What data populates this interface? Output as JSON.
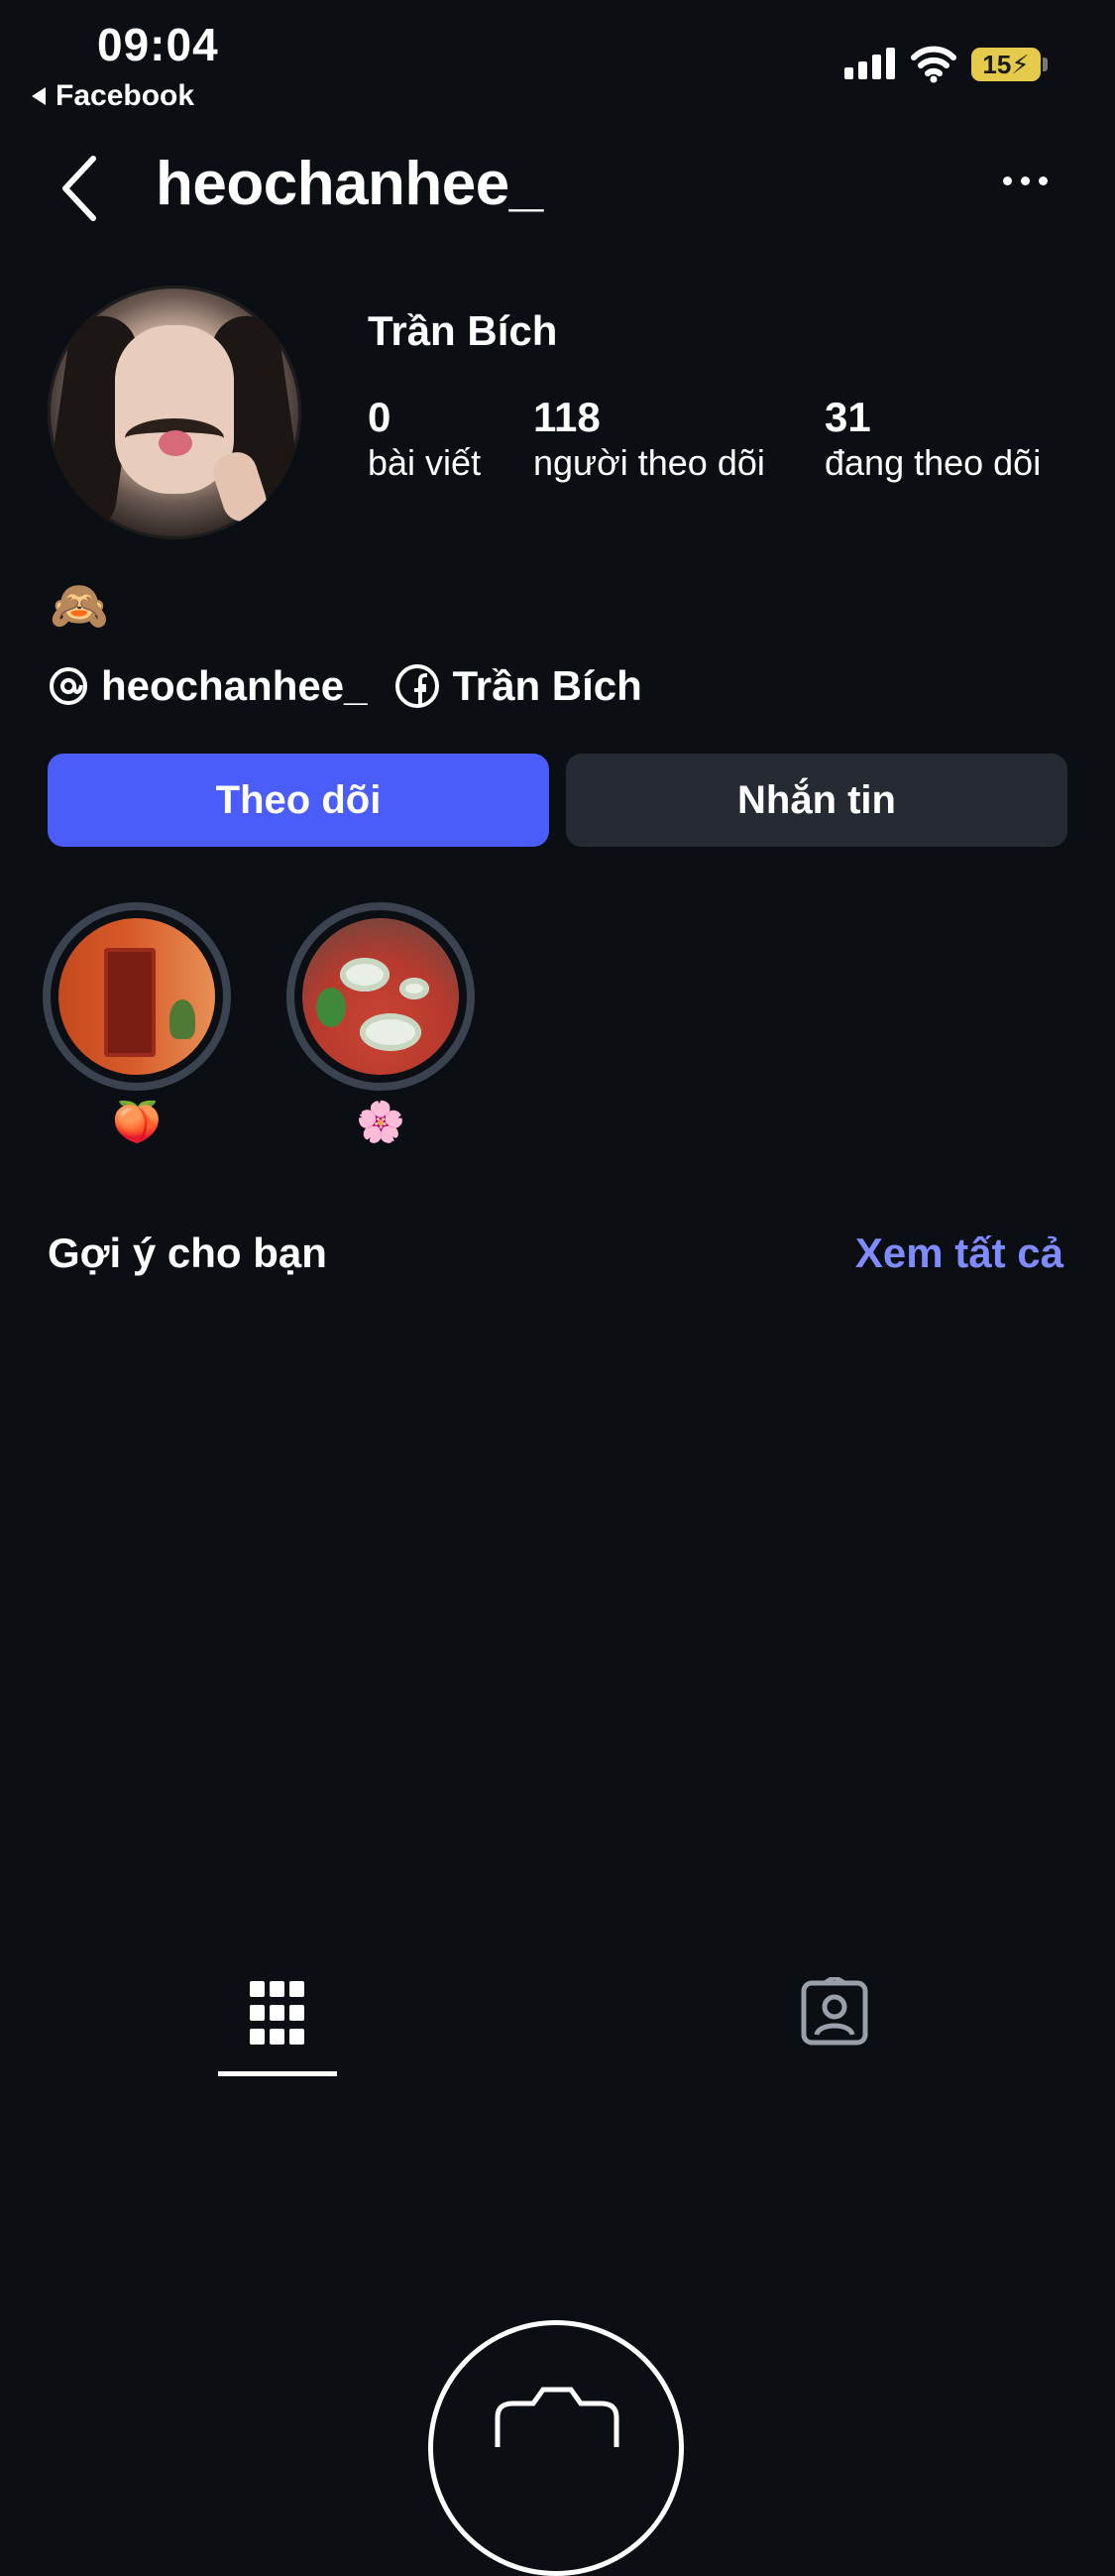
{
  "status_bar": {
    "time": "09:04",
    "back_app": "Facebook",
    "battery": "15"
  },
  "header": {
    "username": "heochanhee_"
  },
  "profile": {
    "display_name": "Trần Bích",
    "stats": [
      {
        "value": "0",
        "label": "bài viết"
      },
      {
        "value": "118",
        "label": "người theo dõi"
      },
      {
        "value": "31",
        "label": "đang theo dõi"
      }
    ],
    "bio_emoji": "🙈",
    "links": {
      "threads": "heochanhee_",
      "facebook": "Trần Bích"
    }
  },
  "actions": {
    "follow": "Theo dõi",
    "message": "Nhắn tin"
  },
  "highlights": [
    {
      "caption": "🍑",
      "icon": "door-photo"
    },
    {
      "caption": "🌸",
      "icon": "food-photo"
    }
  ],
  "suggestions": {
    "title": "Gợi ý cho bạn",
    "see_all": "Xem tất cả"
  },
  "tabs": [
    {
      "icon": "grid-icon",
      "active": true
    },
    {
      "icon": "tagged-icon",
      "active": false
    }
  ],
  "colors": {
    "background": "#0b0e13",
    "primary_button": "#4a5df9",
    "secondary_button": "#262a32",
    "link_accent": "#7f8cff",
    "battery": "#e5c94a"
  }
}
